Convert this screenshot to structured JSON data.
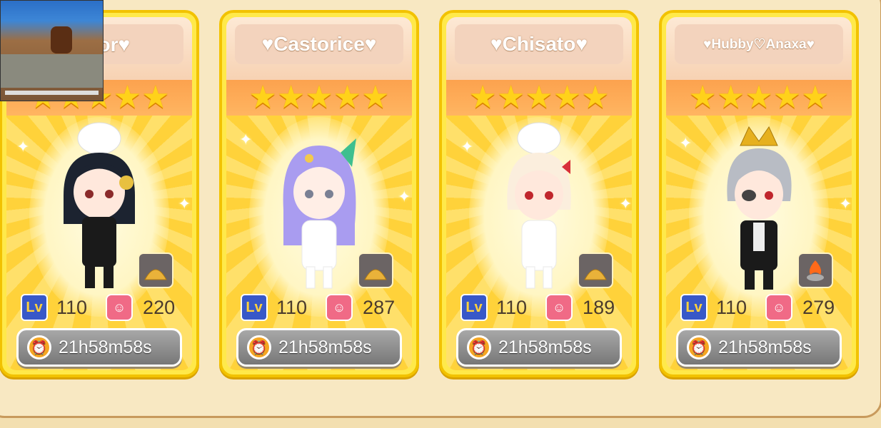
{
  "cards": [
    {
      "name": "♡Yor♥",
      "stars": "★★★★★",
      "level_icon": "Lv",
      "level": "110",
      "affection": "220",
      "timer": "21h58m58s",
      "item_icon": "gold-pile-icon"
    },
    {
      "name": "♥Castorice♥",
      "stars": "★★★★★",
      "level_icon": "Lv",
      "level": "110",
      "affection": "287",
      "timer": "21h58m58s",
      "item_icon": "gold-pile-icon"
    },
    {
      "name": "♥Chisato♥",
      "stars": "★★★★★",
      "level_icon": "Lv",
      "level": "110",
      "affection": "189",
      "timer": "21h58m58s",
      "item_icon": "gold-pile-icon"
    },
    {
      "name": "♥Hubby♡Anaxa♥",
      "stars": "★★★★★",
      "level_icon": "Lv",
      "level": "110",
      "affection": "279",
      "timer": "21h58m58s",
      "item_icon": "fire-pot-icon"
    }
  ],
  "colors": {
    "card_border": "#f2c200",
    "stars": "#ffd21a",
    "timer_button": "#8f8f8f",
    "level_icon": "#3858c8",
    "affection_icon": "#f06a86"
  }
}
